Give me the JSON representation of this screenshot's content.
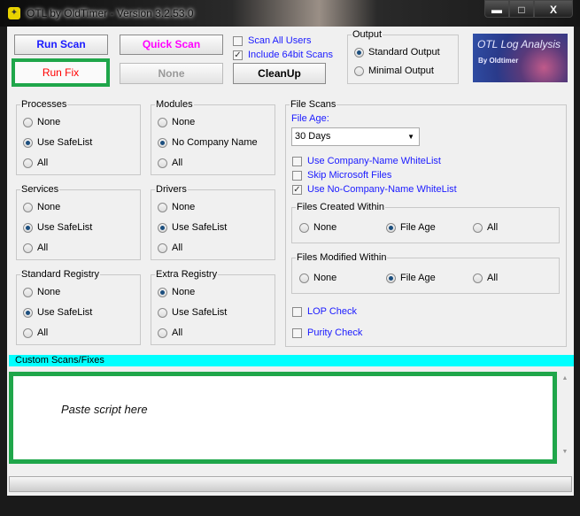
{
  "window": {
    "title": "OTL by OldTimer - Version 3.2.53.0",
    "minimize": "▬",
    "maximize": "□",
    "close": "X"
  },
  "toolbar": {
    "run_scan": "Run Scan",
    "run_fix": "Run Fix",
    "quick_scan": "Quick Scan",
    "none": "None",
    "cleanup": "CleanUp",
    "scan_all_users": {
      "label": "Scan All Users",
      "checked": false
    },
    "include_64bit": {
      "label": "Include 64bit Scans",
      "checked": true
    }
  },
  "output": {
    "title": "Output",
    "options": [
      "Standard Output",
      "Minimal Output"
    ],
    "selected": "Standard Output"
  },
  "logo": {
    "text": "OTL Log Analysis",
    "sub": "By Oldtimer"
  },
  "groups": [
    {
      "title": "Processes",
      "options": [
        "None",
        "Use SafeList",
        "All"
      ],
      "selected": 1
    },
    {
      "title": "Modules",
      "options": [
        "None",
        "No Company Name",
        "All"
      ],
      "selected": 1
    },
    {
      "title": "Services",
      "options": [
        "None",
        "Use SafeList",
        "All"
      ],
      "selected": 1
    },
    {
      "title": "Drivers",
      "options": [
        "None",
        "Use SafeList",
        "All"
      ],
      "selected": 1
    },
    {
      "title": "Standard Registry",
      "options": [
        "None",
        "Use SafeList",
        "All"
      ],
      "selected": 1
    },
    {
      "title": "Extra Registry",
      "options": [
        "None",
        "Use SafeList",
        "All"
      ],
      "selected": 0
    }
  ],
  "file_scans": {
    "title": "File Scans",
    "file_age_label": "File Age:",
    "file_age": "30 Days",
    "checks": [
      {
        "label": "Use Company-Name WhiteList",
        "checked": false
      },
      {
        "label": "Skip Microsoft Files",
        "checked": false
      },
      {
        "label": "Use No-Company-Name WhiteList",
        "checked": true
      }
    ],
    "created": {
      "title": "Files Created Within",
      "options": [
        "None",
        "File Age",
        "All"
      ],
      "selected": 1
    },
    "modified": {
      "title": "Files Modified Within",
      "options": [
        "None",
        "File Age",
        "All"
      ],
      "selected": 1
    },
    "lop": {
      "label": "LOP Check",
      "checked": false
    },
    "purity": {
      "label": "Purity Check",
      "checked": false
    }
  },
  "custom": {
    "title": "Custom Scans/Fixes",
    "placeholder": "Paste script here"
  },
  "colors": {
    "highlight": "#1fa64a",
    "cyan": "#00ffff",
    "blue_text": "#1a1aff",
    "magenta": "#ff00ff",
    "red": "#ff0000"
  }
}
